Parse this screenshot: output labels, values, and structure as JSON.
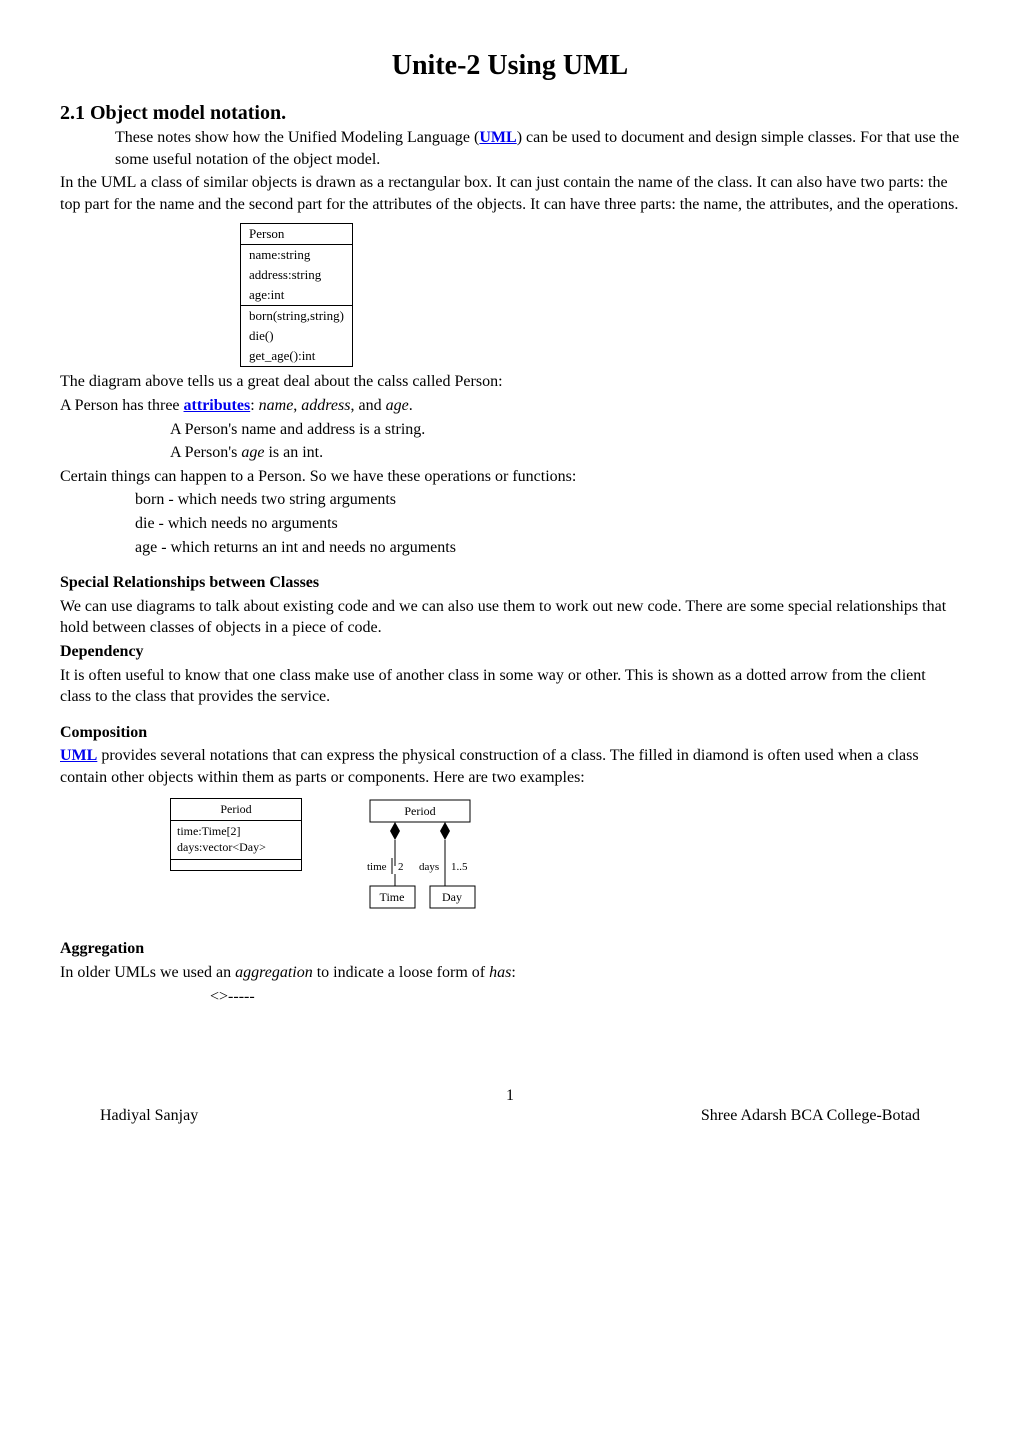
{
  "title": "Unite-2    Using UML",
  "section21": "2.1 Object model notation.",
  "p1_a": "These notes show how the Unified Modeling Language (",
  "p1_link": "UML",
  "p1_b": ") can be used to document and design simple classes. For that use the some useful notation of the object model.",
  "p2": "In the UML a class of similar objects is drawn as a rectangular box. It can just contain the name of the class. It can also have two parts: the top part for the name and the second part for the attributes of the objects. It can have three parts: the name, the attributes, and the operations.",
  "uml": {
    "name": "Person",
    "attr1": "name:string",
    "attr2": "address:string",
    "attr3": "age:int",
    "op1": "born(string,string)",
    "op2": "die()",
    "op3": "get_age():int"
  },
  "p3": "The diagram above tells us a great deal about the calss called Person:",
  "p4_a": "A Person has three ",
  "p4_link": "attributes",
  "p4_b": ": ",
  "p4_i1": "name",
  "p4_c": ", ",
  "p4_i2": "address",
  "p4_d": ", and ",
  "p4_i3": "age",
  "p4_e": ".",
  "p5": "A Person's name and address is a string.",
  "p6_a": "A Person's ",
  "p6_i": "age",
  "p6_b": " is an int.",
  "p7": "Certain things can happen to a Person. So we have these operations or functions:",
  "p8": "born - which needs two string arguments",
  "p9": "die - which needs no arguments",
  "p10": "age - which returns an int and needs no arguments",
  "h_special": "Special Relationships between Classes",
  "p11": "We can use diagrams to talk about existing code and we can also use them to work out new code. There are some special relationships that hold between classes of objects in a piece of code.",
  "h_dep": "Dependency",
  "p12": "It is often useful to know that one class make use of another class in some way or other. This is shown as a dotted arrow from the client class to the class that provides the service.",
  "h_comp": "Composition",
  "p13_link": "UML",
  "p13_a": " provides several notations that can express the physical construction of a class. The filled in diamond is often used when a class contain other objects within them as parts or components. Here are two examples:",
  "comp_left": {
    "name": "Period",
    "a1": "time:Time[2]",
    "a2": "days:vector<Day>"
  },
  "comp_right": {
    "period": "Period",
    "time_lbl": "time",
    "time_mult": "2",
    "days_lbl": "days",
    "days_mult": "1..5",
    "time_cls": "Time",
    "day_cls": "Day"
  },
  "h_agg": "Aggregation",
  "p14_a": "In older UMLs we used an ",
  "p14_i": "aggregation",
  "p14_b": " to indicate a loose form of ",
  "p14_i2": "has",
  "p14_c": ":",
  "p15": "<>-----",
  "page_num": "1",
  "foot_left": "Hadiyal Sanjay",
  "foot_right": "Shree Adarsh BCA College-Botad"
}
